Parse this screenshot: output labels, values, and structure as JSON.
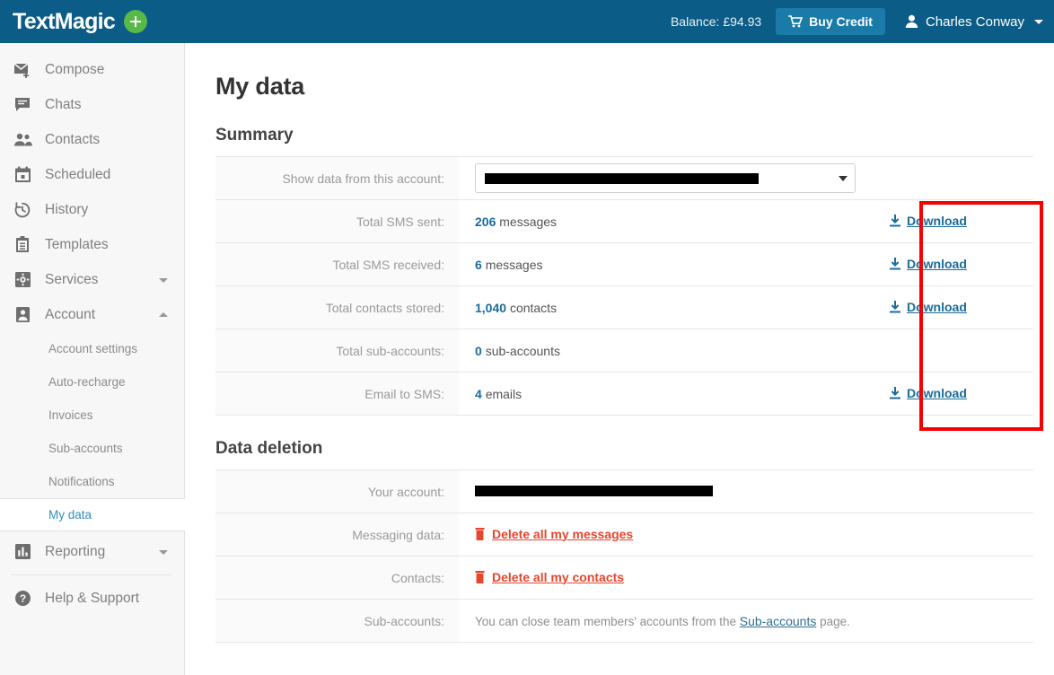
{
  "brand": {
    "name": "TextMagic",
    "plus_icon": "plus-circle-icon",
    "accent_blue": "#0b5c86",
    "accent_green": "#58b947"
  },
  "topbar": {
    "balance_label": "Balance: £94.93",
    "buy_credit_label": "Buy Credit",
    "cart_icon": "shopping-cart-icon",
    "user_icon": "person-icon",
    "user_name": "Charles Conway",
    "caret_icon": "caret-down-icon"
  },
  "sidebar": {
    "items": [
      {
        "label": "Compose",
        "icon": "envelope-plus-icon"
      },
      {
        "label": "Chats",
        "icon": "chat-bubble-icon"
      },
      {
        "label": "Contacts",
        "icon": "people-icon"
      },
      {
        "label": "Scheduled",
        "icon": "calendar-icon"
      },
      {
        "label": "History",
        "icon": "clock-history-icon"
      },
      {
        "label": "Templates",
        "icon": "clipboard-icon"
      },
      {
        "label": "Services",
        "icon": "gear-box-icon",
        "caret": "caret-down-icon"
      },
      {
        "label": "Account",
        "icon": "person-box-icon",
        "caret": "caret-up-icon"
      }
    ],
    "account_subitems": [
      {
        "label": "Account settings",
        "active": false
      },
      {
        "label": "Auto-recharge",
        "active": false
      },
      {
        "label": "Invoices",
        "active": false
      },
      {
        "label": "Sub-accounts",
        "active": false
      },
      {
        "label": "Notifications",
        "active": false
      },
      {
        "label": "My data",
        "active": true
      }
    ],
    "items_after": [
      {
        "label": "Reporting",
        "icon": "bar-chart-icon",
        "caret": "caret-down-icon"
      },
      {
        "label": "Help & Support",
        "icon": "question-circle-icon"
      }
    ]
  },
  "page": {
    "title": "My data"
  },
  "summary": {
    "heading": "Summary",
    "rows": [
      {
        "label": "Show data from this account:",
        "type": "select",
        "value_redacted": true,
        "redact_width": 305,
        "caret_icon": "caret-down-icon",
        "action": null
      },
      {
        "label": "Total SMS sent:",
        "type": "value",
        "number": "206",
        "unit": "messages",
        "action": "Download",
        "action_icon": "download-icon"
      },
      {
        "label": "Total SMS received:",
        "type": "value",
        "number": "6",
        "unit": "messages",
        "action": "Download",
        "action_icon": "download-icon"
      },
      {
        "label": "Total contacts stored:",
        "type": "value",
        "number": "1,040",
        "unit": "contacts",
        "action": "Download",
        "action_icon": "download-icon"
      },
      {
        "label": "Total sub-accounts:",
        "type": "value",
        "number": "0",
        "unit": "sub-accounts",
        "action": null
      },
      {
        "label": "Email to SMS:",
        "type": "value",
        "number": "4",
        "unit": "emails",
        "action": "Download",
        "action_icon": "download-icon"
      }
    ]
  },
  "data_deletion": {
    "heading": "Data deletion",
    "rows": [
      {
        "label": "Your account:",
        "type": "redacted",
        "redact_width": 265
      },
      {
        "label": "Messaging data:",
        "type": "delete",
        "link": "Delete all my messages",
        "icon": "trash-icon"
      },
      {
        "label": "Contacts:",
        "type": "delete",
        "link": "Delete all my contacts",
        "icon": "trash-icon"
      },
      {
        "label": "Sub-accounts:",
        "type": "note",
        "text_before": "You can close team members' accounts from the ",
        "link": "Sub-accounts",
        "text_after": " page."
      }
    ]
  },
  "annotation": {
    "name": "download-column-highlight",
    "color": "#f60000"
  }
}
